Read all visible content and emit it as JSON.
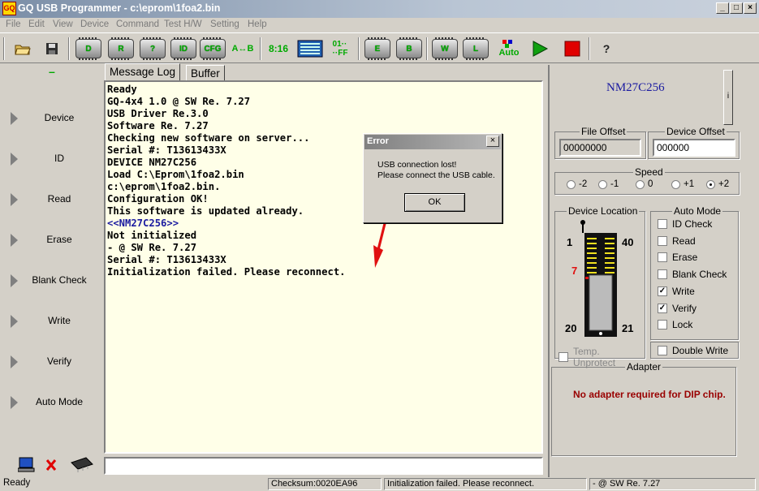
{
  "window": {
    "title": "GQ USB Programmer - c:\\eprom\\1foa2.bin",
    "app_icon": "GQ"
  },
  "menu": [
    "File",
    "Edit",
    "View",
    "Device",
    "Command",
    "Test H/W",
    "Setting",
    "Help"
  ],
  "toolbar": {
    "read_label": "R",
    "id_label": "ID",
    "ab_label": "A↔B",
    "bits_label": "8:16",
    "ff_label": "01··\n··FF",
    "auto_label": "Auto",
    "help_label": "?",
    "device_label": "D",
    "verify_label": "?",
    "cfg_label": "CFG",
    "e_label": "E",
    "b_label": "B",
    "w_label": "W",
    "l_label": "L"
  },
  "sidebar": {
    "indicator": "–",
    "items": [
      "Device",
      "ID",
      "Read",
      "Erase",
      "Blank Check",
      "Write",
      "Verify",
      "Auto Mode"
    ]
  },
  "tabs": {
    "message_log": "Message Log",
    "buffer": "Buffer"
  },
  "log": [
    {
      "text": "Ready",
      "color": "#000000"
    },
    {
      "text": "GQ-4x4 1.0 @ SW Re. 7.27",
      "color": "#000000"
    },
    {
      "text": "USB Driver Re.3.0",
      "color": "#000000"
    },
    {
      "text": "Software Re. 7.27",
      "color": "#000000"
    },
    {
      "text": "Checking new software on server...",
      "color": "#000000"
    },
    {
      "text": "Serial #: T13613433X",
      "color": "#000000"
    },
    {
      "text": "DEVICE NM27C256",
      "color": "#000000"
    },
    {
      "text": "Load C:\\Eprom\\1foa2.bin",
      "color": "#000000"
    },
    {
      "text": "c:\\eprom\\1foa2.bin.",
      "color": "#000000"
    },
    {
      "text": "Configuration OK!",
      "color": "#000000"
    },
    {
      "text": "This software is updated already.",
      "color": "#000000"
    },
    {
      "text": "<<NM27C256>>",
      "color": "#1a1aa0"
    },
    {
      "text": "Not initialized",
      "color": "#000000"
    },
    {
      "text": "- @ SW Re. 7.27",
      "color": "#000000"
    },
    {
      "text": "Serial #: T13613433X",
      "color": "#000000"
    },
    {
      "text": "Initialization failed. Please reconnect.",
      "color": "#000000"
    }
  ],
  "dialog": {
    "title": "Error",
    "close": "×",
    "line1": "USB connection lost!",
    "line2": "Please connect the USB cable.",
    "ok": "OK"
  },
  "device": {
    "name": "NM27C256",
    "info_btn": "i"
  },
  "file_offset": {
    "label": "File Offset",
    "value": "00000000"
  },
  "device_offset": {
    "label": "Device Offset",
    "value": "000000"
  },
  "speed": {
    "label": "Speed",
    "options": [
      "-2",
      "-1",
      "0",
      "+1",
      "+2"
    ],
    "selected": "+2"
  },
  "device_location": {
    "label": "Device Location",
    "pin_top_left": "1",
    "pin_top_right": "40",
    "pin_marker": "7",
    "pin_bottom_left": "20",
    "pin_bottom_right": "21",
    "temp_unprotect": "Temp. Unprotect"
  },
  "auto_mode": {
    "label": "Auto Mode",
    "items": [
      {
        "label": "ID Check",
        "checked": false
      },
      {
        "label": "Read",
        "checked": false
      },
      {
        "label": "Erase",
        "checked": false
      },
      {
        "label": "Blank Check",
        "checked": false
      },
      {
        "label": "Write",
        "checked": true
      },
      {
        "label": "Verify",
        "checked": true
      },
      {
        "label": "Lock",
        "checked": false
      }
    ],
    "double_write": "Double Write"
  },
  "adapter": {
    "label": "Adapter",
    "message": "No adapter required for DIP chip."
  },
  "status": {
    "ready": "Ready",
    "checksum": "Checksum:0020EA96",
    "message": "Initialization failed. Please reconnect.",
    "version": "- @ SW Re. 7.27"
  },
  "colors": {
    "accent_blue": "#1a1aa0",
    "error_red": "#990000",
    "arrow_red": "#e01010"
  }
}
